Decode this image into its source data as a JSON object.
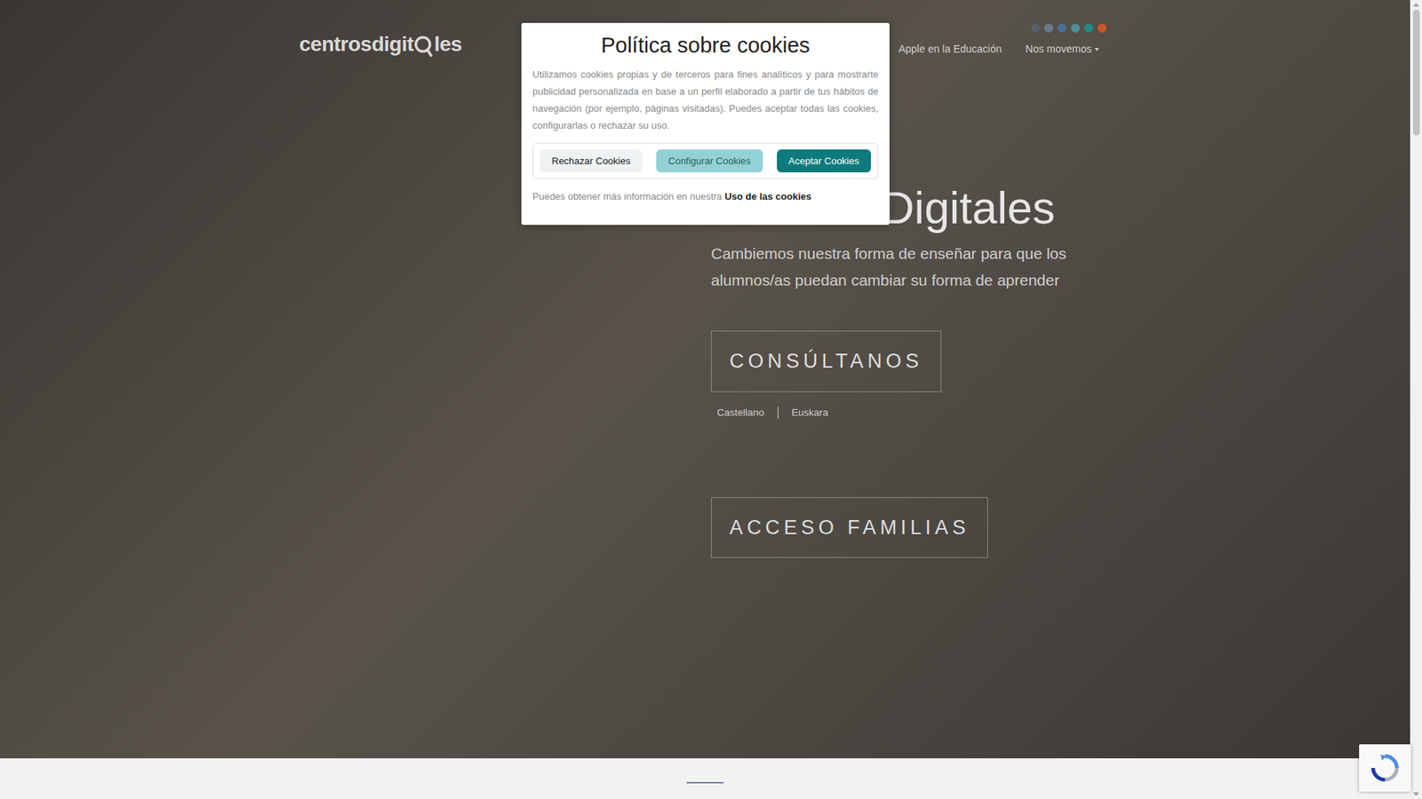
{
  "nav": {
    "logo": {
      "before": "centrosdigit",
      "after": "les"
    },
    "dots": [
      {
        "color": "#555f6b"
      },
      {
        "color": "#6a7b8c"
      },
      {
        "color": "#4a6d94"
      },
      {
        "color": "#4f8f99"
      },
      {
        "color": "#1e8b86"
      },
      {
        "color": "#c55a22"
      }
    ],
    "links": [
      {
        "label": "Apple en la Educación",
        "dropdown": false
      },
      {
        "label": "Nos movemos",
        "dropdown": true
      }
    ]
  },
  "hero": {
    "title": "Centros Digitales",
    "subtitle": "Cambiemos nuestra forma de enseñar para que los alumnos/as puedan cambiar su forma de aprender",
    "primary_button": "CONSÚLTANOS",
    "languages": [
      "Castellano",
      "Euskara"
    ],
    "secondary_button": "ACCESO FAMILIAS"
  },
  "cookie_dialog": {
    "title": "Política sobre cookies",
    "body": "Utilizamos cookies propias y de terceros para fines analíticos y para mostrarte publicidad personalizada en base a un perfil elaborado a partir de tus hábitos de navegación (por ejemplo, páginas visitadas). Puedes aceptar todas las cookies, configurarlas o rechazar su uso.",
    "buttons": [
      {
        "label": "Rechazar Cookies",
        "kind": "reject"
      },
      {
        "label": "Configurar Cookies",
        "kind": "configure"
      },
      {
        "label": "Aceptar Cookies",
        "kind": "accept"
      }
    ],
    "footer": "Puedes obtener más información en nuestra",
    "footer_link": "Uso de las cookies"
  }
}
